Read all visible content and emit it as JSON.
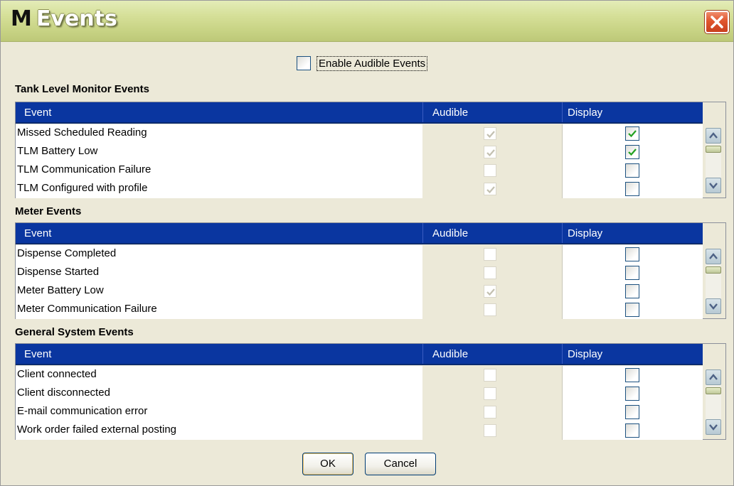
{
  "window": {
    "title_icon": "M",
    "title": "Events",
    "close_icon": "close-icon"
  },
  "enable_audible": {
    "label": "Enable Audible Events",
    "checked": false
  },
  "columns": {
    "event": "Event",
    "audible": "Audible",
    "display": "Display"
  },
  "sections": [
    {
      "title": "Tank Level Monitor Events",
      "rows": [
        {
          "event": "Missed Scheduled Reading",
          "audible": true,
          "display": true
        },
        {
          "event": "TLM Battery Low",
          "audible": true,
          "display": true
        },
        {
          "event": "TLM Communication Failure",
          "audible": false,
          "display": false
        },
        {
          "event": "TLM Configured with profile",
          "audible": true,
          "display": false
        }
      ]
    },
    {
      "title": "Meter Events",
      "rows": [
        {
          "event": "Dispense Completed",
          "audible": false,
          "display": false
        },
        {
          "event": "Dispense Started",
          "audible": false,
          "display": false
        },
        {
          "event": "Meter Battery Low",
          "audible": true,
          "display": false
        },
        {
          "event": "Meter Communication Failure",
          "audible": false,
          "display": false
        }
      ]
    },
    {
      "title": "General System Events",
      "rows": [
        {
          "event": "Client connected",
          "audible": false,
          "display": false
        },
        {
          "event": "Client disconnected",
          "audible": false,
          "display": false
        },
        {
          "event": "E-mail communication error",
          "audible": false,
          "display": false
        },
        {
          "event": "Work order failed external posting",
          "audible": false,
          "display": false
        }
      ]
    }
  ],
  "buttons": {
    "ok": "OK",
    "cancel": "Cancel"
  },
  "colors": {
    "header_bg": "#0a36a0",
    "check_green": "#21a121",
    "title_gradient": "#c9d486"
  }
}
